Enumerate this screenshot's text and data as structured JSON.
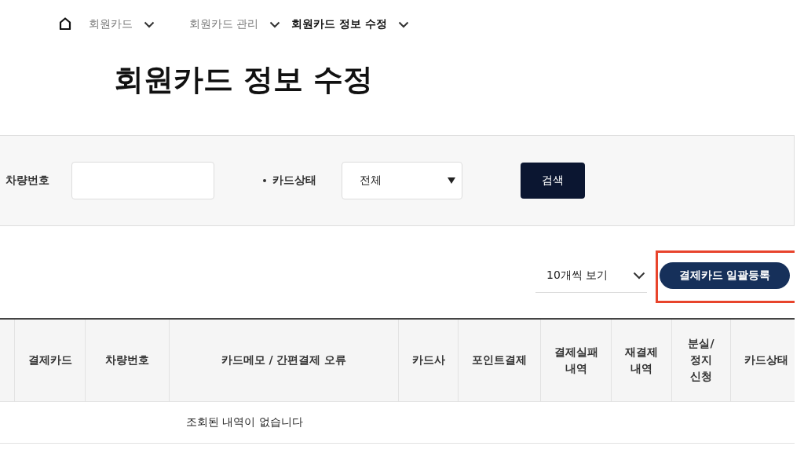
{
  "breadcrumb": [
    {
      "label": "회원카드",
      "current": false
    },
    {
      "label": "회원카드 관리",
      "current": false
    },
    {
      "label": "회원카드 정보 수정",
      "current": true
    }
  ],
  "title": "회원카드 정보 수정",
  "search": {
    "fields": [
      {
        "kind": "input",
        "label": "차량번호",
        "bullet": false
      },
      {
        "kind": "select",
        "label": "카드상태",
        "bullet": true,
        "value": "전체"
      }
    ],
    "button": "검색"
  },
  "toolbar": {
    "page_size": "10개씩 보기",
    "action_button": {
      "label": "결제카드 일괄등록",
      "highlighted": true
    }
  },
  "table": {
    "columns": [
      [
        "결제카드"
      ],
      [
        "차량번호"
      ],
      [
        "카드메모 / 간편결제 오류"
      ],
      [
        "카드사"
      ],
      [
        "포인트결제"
      ],
      [
        "결제실패",
        "내역"
      ],
      [
        "재결제",
        "내역"
      ],
      [
        "분실/",
        "정지",
        "신청"
      ],
      [
        "카드상태"
      ]
    ],
    "empty_message": "조회된 내역이 없습니다"
  }
}
